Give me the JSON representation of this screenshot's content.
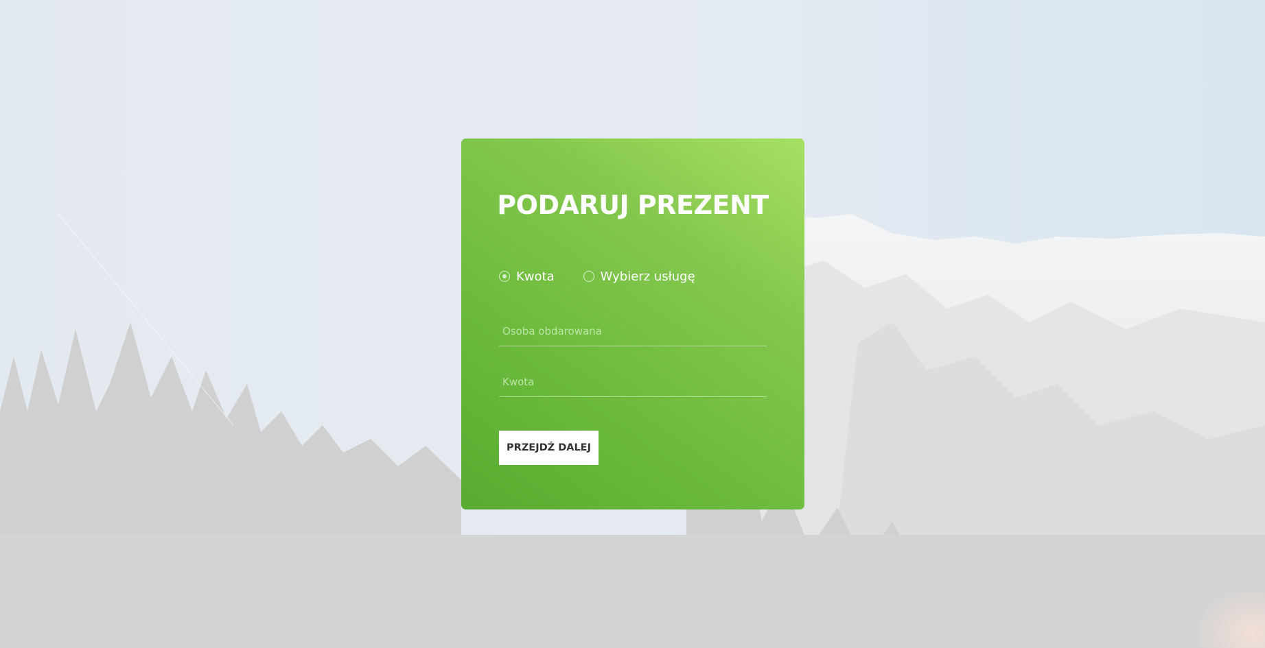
{
  "form": {
    "title": "PODARUJ PREZENT",
    "radio_options": [
      {
        "label": "Kwota",
        "checked": true
      },
      {
        "label": "Wybierz usługę",
        "checked": false
      }
    ],
    "recipient_placeholder": "Osoba obdarowana",
    "amount_placeholder": "Kwota",
    "submit_label": "PRZEJDŹ DALEJ"
  },
  "colors": {
    "card_gradient_start": "#58ab2f",
    "card_gradient_end": "#a6e063",
    "button_background": "#ffffff",
    "button_text": "#333333"
  }
}
